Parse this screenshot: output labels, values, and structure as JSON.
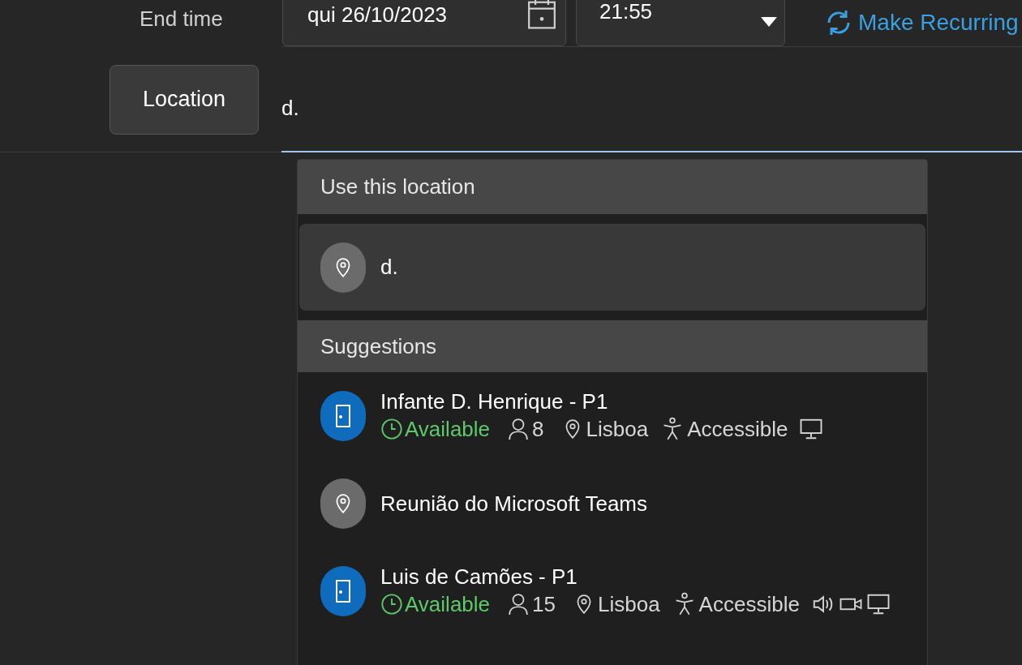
{
  "end_time": {
    "label": "End time",
    "date": "qui 26/10/2023",
    "time": "21:55",
    "recurring_link": "Make Recurring"
  },
  "location": {
    "button": "Location",
    "value": "d."
  },
  "dropdown": {
    "use_header": "Use this location",
    "use_item": {
      "text": "d.",
      "selected": true
    },
    "suggestions_header": "Suggestions",
    "suggestions": [
      {
        "kind": "room",
        "name": "Infante D. Henrique - P1",
        "status": "Available",
        "capacity": "8",
        "city": "Lisboa",
        "accessibility": "Accessible",
        "equipment": [
          {
            "kind": "display"
          }
        ]
      },
      {
        "kind": "place",
        "name": "Reunião do Microsoft Teams"
      },
      {
        "kind": "room",
        "name": "Luis de Camões - P1",
        "status": "Available",
        "capacity": "15",
        "city": "Lisboa",
        "accessibility": "Accessible",
        "equipment": [
          {
            "kind": "audio"
          },
          {
            "kind": "video"
          },
          {
            "kind": "display"
          }
        ]
      }
    ]
  }
}
